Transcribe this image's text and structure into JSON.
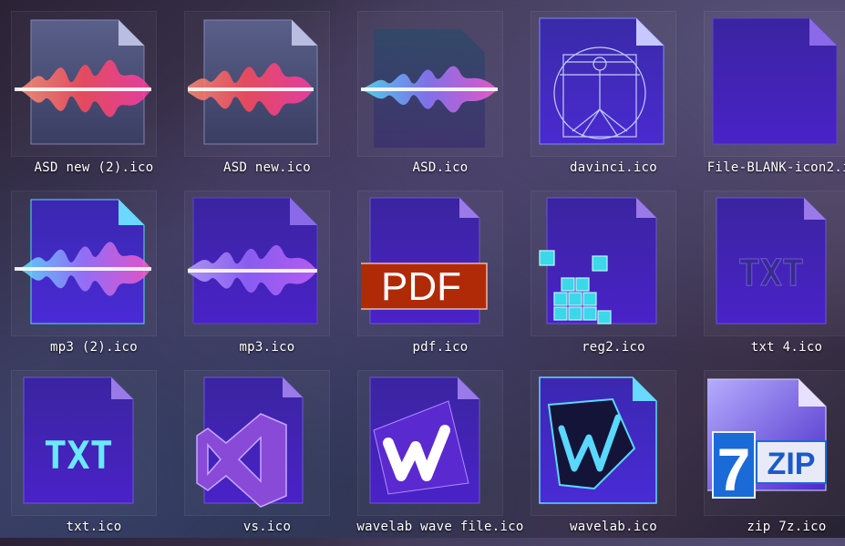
{
  "files": [
    {
      "name": "ASD new (2).ico",
      "icon": "audio-wave-red-icon"
    },
    {
      "name": "ASD new.ico",
      "icon": "audio-wave-red-icon"
    },
    {
      "name": "ASD.ico",
      "icon": "audio-wave-blue-icon"
    },
    {
      "name": "davinci.ico",
      "icon": "vitruvian-man-icon"
    },
    {
      "name": "File-BLANK-icon2.ico",
      "icon": "blank-file-icon"
    },
    {
      "name": "mp3 (2).ico",
      "icon": "audio-wave-cyan-icon"
    },
    {
      "name": "mp3.ico",
      "icon": "audio-wave-purple-icon"
    },
    {
      "name": "pdf.ico",
      "icon": "pdf-file-icon",
      "badge": "PDF"
    },
    {
      "name": "reg2.ico",
      "icon": "registry-cubes-icon"
    },
    {
      "name": "txt 4.ico",
      "icon": "txt-file-icon",
      "badge": "TXT"
    },
    {
      "name": "txt.ico",
      "icon": "txt-glow-file-icon",
      "badge": "TXT"
    },
    {
      "name": "vs.ico",
      "icon": "visual-studio-icon"
    },
    {
      "name": "wavelab wave file.ico",
      "icon": "wavelab-file-icon"
    },
    {
      "name": "wavelab.ico",
      "icon": "wavelab-icon"
    },
    {
      "name": "zip 7z.ico",
      "icon": "7zip-icon",
      "badge": "7",
      "badge2": "ZIP"
    }
  ]
}
